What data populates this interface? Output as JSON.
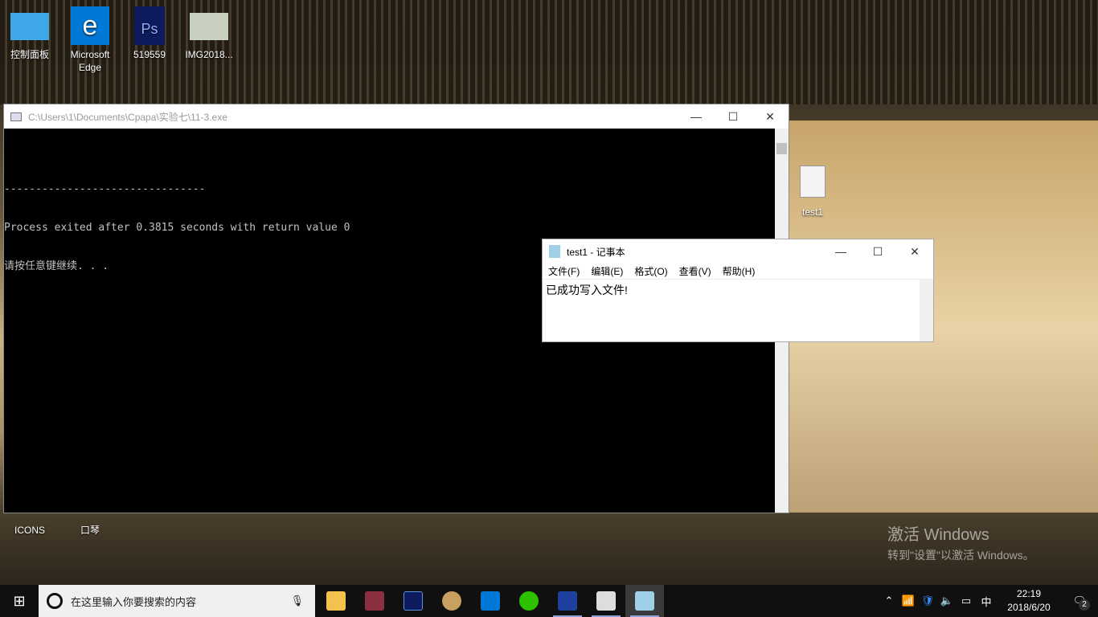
{
  "desktop": {
    "icons": [
      {
        "label": "控制面板",
        "color": "#3ea7e8"
      },
      {
        "label": "Microsoft Edge",
        "color": "#0078d7"
      },
      {
        "label": "519559",
        "color": "#0d1a5e"
      },
      {
        "label": "IMG2018...",
        "color": "#6b6b5b"
      },
      {
        "label": "ICONS",
        "color": "#c03030"
      },
      {
        "label": "口琴",
        "color": "#e8e4c8"
      },
      {
        "label": "test1",
        "color": "#f4f4f4"
      }
    ]
  },
  "console": {
    "title": "C:\\Users\\1\\Documents\\Cpapa\\实验七\\11-3.exe",
    "lines": [
      "",
      "--------------------------------",
      "Process exited after 0.3815 seconds with return value 0",
      "请按任意键继续. . ."
    ]
  },
  "notepad": {
    "title": "test1 - 记事本",
    "menu": [
      "文件(F)",
      "编辑(E)",
      "格式(O)",
      "查看(V)",
      "帮助(H)"
    ],
    "content": "已成功写入文件!"
  },
  "watermark": {
    "title": "激活 Windows",
    "subtitle": "转到\"设置\"以激活 Windows。"
  },
  "taskbar": {
    "search_placeholder": "在这里输入你要搜索的内容",
    "time": "22:19",
    "date": "2018/6/20",
    "ime": "中",
    "notifications": "2",
    "apps": [
      {
        "name": "file-explorer",
        "color": "#f2c14e"
      },
      {
        "name": "anime-app",
        "color": "#8a3040"
      },
      {
        "name": "photoshop",
        "color": "#0d1a5e"
      },
      {
        "name": "paint",
        "color": "#c8a060"
      },
      {
        "name": "edge",
        "color": "#0078d7"
      },
      {
        "name": "wechat",
        "color": "#2dc100"
      },
      {
        "name": "dev-cpp",
        "color": "#2040a0"
      },
      {
        "name": "console-window",
        "color": "#ddd"
      },
      {
        "name": "notepad",
        "color": "#9fd0e8"
      }
    ]
  }
}
